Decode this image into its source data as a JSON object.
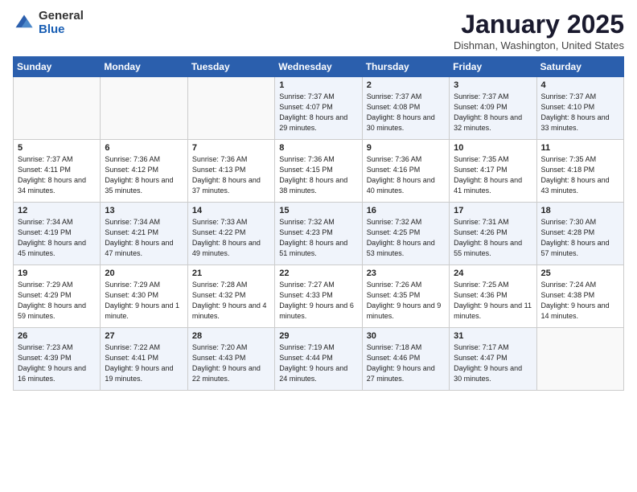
{
  "header": {
    "logo_general": "General",
    "logo_blue": "Blue",
    "title": "January 2025",
    "location": "Dishman, Washington, United States"
  },
  "days_of_week": [
    "Sunday",
    "Monday",
    "Tuesday",
    "Wednesday",
    "Thursday",
    "Friday",
    "Saturday"
  ],
  "weeks": [
    [
      {
        "day": "",
        "info": ""
      },
      {
        "day": "",
        "info": ""
      },
      {
        "day": "",
        "info": ""
      },
      {
        "day": "1",
        "info": "Sunrise: 7:37 AM\nSunset: 4:07 PM\nDaylight: 8 hours and 29 minutes."
      },
      {
        "day": "2",
        "info": "Sunrise: 7:37 AM\nSunset: 4:08 PM\nDaylight: 8 hours and 30 minutes."
      },
      {
        "day": "3",
        "info": "Sunrise: 7:37 AM\nSunset: 4:09 PM\nDaylight: 8 hours and 32 minutes."
      },
      {
        "day": "4",
        "info": "Sunrise: 7:37 AM\nSunset: 4:10 PM\nDaylight: 8 hours and 33 minutes."
      }
    ],
    [
      {
        "day": "5",
        "info": "Sunrise: 7:37 AM\nSunset: 4:11 PM\nDaylight: 8 hours and 34 minutes."
      },
      {
        "day": "6",
        "info": "Sunrise: 7:36 AM\nSunset: 4:12 PM\nDaylight: 8 hours and 35 minutes."
      },
      {
        "day": "7",
        "info": "Sunrise: 7:36 AM\nSunset: 4:13 PM\nDaylight: 8 hours and 37 minutes."
      },
      {
        "day": "8",
        "info": "Sunrise: 7:36 AM\nSunset: 4:15 PM\nDaylight: 8 hours and 38 minutes."
      },
      {
        "day": "9",
        "info": "Sunrise: 7:36 AM\nSunset: 4:16 PM\nDaylight: 8 hours and 40 minutes."
      },
      {
        "day": "10",
        "info": "Sunrise: 7:35 AM\nSunset: 4:17 PM\nDaylight: 8 hours and 41 minutes."
      },
      {
        "day": "11",
        "info": "Sunrise: 7:35 AM\nSunset: 4:18 PM\nDaylight: 8 hours and 43 minutes."
      }
    ],
    [
      {
        "day": "12",
        "info": "Sunrise: 7:34 AM\nSunset: 4:19 PM\nDaylight: 8 hours and 45 minutes."
      },
      {
        "day": "13",
        "info": "Sunrise: 7:34 AM\nSunset: 4:21 PM\nDaylight: 8 hours and 47 minutes."
      },
      {
        "day": "14",
        "info": "Sunrise: 7:33 AM\nSunset: 4:22 PM\nDaylight: 8 hours and 49 minutes."
      },
      {
        "day": "15",
        "info": "Sunrise: 7:32 AM\nSunset: 4:23 PM\nDaylight: 8 hours and 51 minutes."
      },
      {
        "day": "16",
        "info": "Sunrise: 7:32 AM\nSunset: 4:25 PM\nDaylight: 8 hours and 53 minutes."
      },
      {
        "day": "17",
        "info": "Sunrise: 7:31 AM\nSunset: 4:26 PM\nDaylight: 8 hours and 55 minutes."
      },
      {
        "day": "18",
        "info": "Sunrise: 7:30 AM\nSunset: 4:28 PM\nDaylight: 8 hours and 57 minutes."
      }
    ],
    [
      {
        "day": "19",
        "info": "Sunrise: 7:29 AM\nSunset: 4:29 PM\nDaylight: 8 hours and 59 minutes."
      },
      {
        "day": "20",
        "info": "Sunrise: 7:29 AM\nSunset: 4:30 PM\nDaylight: 9 hours and 1 minute."
      },
      {
        "day": "21",
        "info": "Sunrise: 7:28 AM\nSunset: 4:32 PM\nDaylight: 9 hours and 4 minutes."
      },
      {
        "day": "22",
        "info": "Sunrise: 7:27 AM\nSunset: 4:33 PM\nDaylight: 9 hours and 6 minutes."
      },
      {
        "day": "23",
        "info": "Sunrise: 7:26 AM\nSunset: 4:35 PM\nDaylight: 9 hours and 9 minutes."
      },
      {
        "day": "24",
        "info": "Sunrise: 7:25 AM\nSunset: 4:36 PM\nDaylight: 9 hours and 11 minutes."
      },
      {
        "day": "25",
        "info": "Sunrise: 7:24 AM\nSunset: 4:38 PM\nDaylight: 9 hours and 14 minutes."
      }
    ],
    [
      {
        "day": "26",
        "info": "Sunrise: 7:23 AM\nSunset: 4:39 PM\nDaylight: 9 hours and 16 minutes."
      },
      {
        "day": "27",
        "info": "Sunrise: 7:22 AM\nSunset: 4:41 PM\nDaylight: 9 hours and 19 minutes."
      },
      {
        "day": "28",
        "info": "Sunrise: 7:20 AM\nSunset: 4:43 PM\nDaylight: 9 hours and 22 minutes."
      },
      {
        "day": "29",
        "info": "Sunrise: 7:19 AM\nSunset: 4:44 PM\nDaylight: 9 hours and 24 minutes."
      },
      {
        "day": "30",
        "info": "Sunrise: 7:18 AM\nSunset: 4:46 PM\nDaylight: 9 hours and 27 minutes."
      },
      {
        "day": "31",
        "info": "Sunrise: 7:17 AM\nSunset: 4:47 PM\nDaylight: 9 hours and 30 minutes."
      },
      {
        "day": "",
        "info": ""
      }
    ]
  ]
}
